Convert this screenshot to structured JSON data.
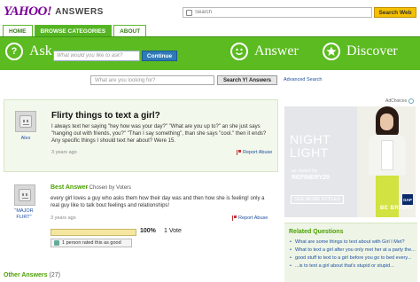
{
  "header": {
    "logo_yahoo": "YAHOO!",
    "logo_answers": "ANSWERS",
    "search_placeholder": "Search",
    "search_web_label": "Search Web"
  },
  "tabs": [
    {
      "label": "HOME",
      "active": false
    },
    {
      "label": "BROWSE CATEGORIES",
      "active": true
    },
    {
      "label": "ABOUT",
      "active": false
    }
  ],
  "greenbar": {
    "ask_icon": "?",
    "ask_label": "Ask",
    "ask_placeholder": "What would you like to ask?",
    "continue_label": "Continue",
    "answer_icon": "smiley-icon",
    "answer_label": "Answer",
    "discover_icon": "star-icon",
    "discover_label": "Discover"
  },
  "question_search": {
    "placeholder": "What are you looking for?",
    "button_label": "Search Y! Answers",
    "advanced_label": "Advanced Search"
  },
  "question": {
    "user": "Alex",
    "title": "Flirty things to text a girl?",
    "body": "I always text her saying \"hey how was your day?\" \"What are you up to?\" an she just says \"hanging out with friends, you?\" \"Than I say something\", than she says \"cool.\" then it ends? Any specific things I should text her about? Were 15.",
    "time": "3 years ago",
    "report_label": "Report Abuse"
  },
  "best_answer": {
    "label": "Best Answer",
    "chosen_by": "- Chosen by Voters",
    "user": "\"MAJOR FLIRT\"",
    "body": "every girl loves a guy who asks them how their day was and then how she is feeling! only a real guy like to talk bout feelings and relationships!",
    "time": "3 years ago",
    "report_label": "Report Abuse",
    "vote_fraction": 1.0,
    "vote_pct": "100%",
    "vote_count": "1 Vote",
    "rated_text": "1 person rated this as good"
  },
  "other_answers": {
    "label": "Other Answers",
    "count": "(27)"
  },
  "ad": {
    "adchoices_label": "AdChoices",
    "title_line1": "NIGHT",
    "title_line2": "LIGHT",
    "styled_by": "as styled by",
    "refinery": "REFINERY29",
    "cta": "SEE MORE STYLES",
    "tagline": "BE BRIGHT",
    "brand": "GAP"
  },
  "related": {
    "title": "Related Questions",
    "items": [
      "What are some things to text about with Girl I Met?",
      "What to text a girl after you only met her at a party the...",
      "good stuff to text to a girl before you go to bed every...",
      "...is to text a girl about that's stupid or stupid..."
    ]
  },
  "colors": {
    "brand_purple": "#7b0099",
    "green": "#5bbb20",
    "link_blue": "#2050a0",
    "search_yellow": "#f5c000"
  }
}
